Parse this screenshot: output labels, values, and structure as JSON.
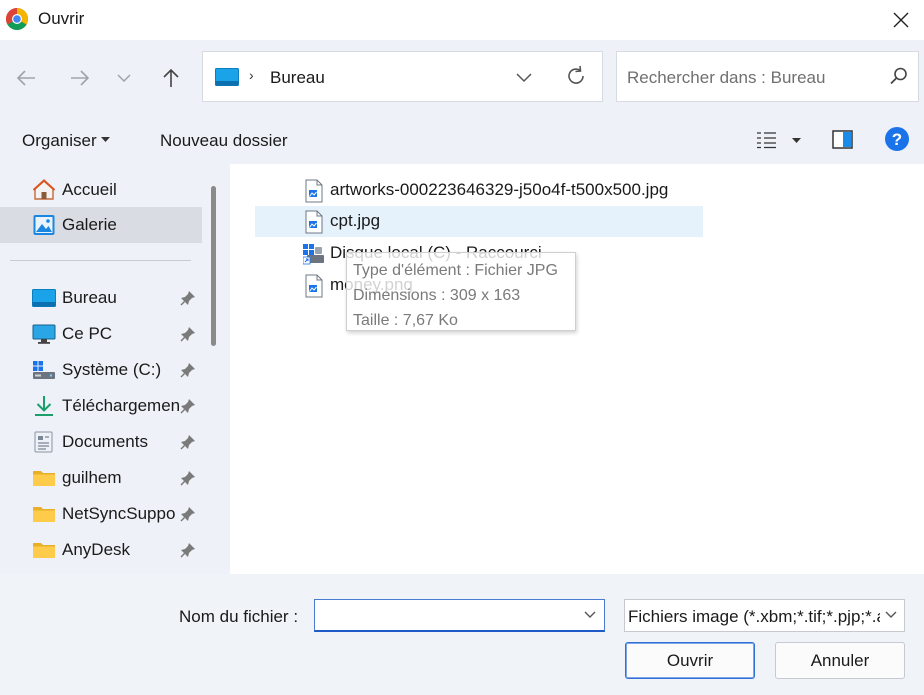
{
  "window": {
    "title": "Ouvrir"
  },
  "address": {
    "crumb": "Bureau"
  },
  "search": {
    "placeholder": "Rechercher dans : Bureau"
  },
  "toolbar": {
    "organize_label": "Organiser",
    "new_folder_label": "Nouveau dossier"
  },
  "sidebar": {
    "items": [
      {
        "label": "Accueil",
        "icon": "home-icon"
      },
      {
        "label": "Galerie",
        "icon": "gallery-icon"
      },
      {
        "label": "Bureau",
        "icon": "desktop-icon"
      },
      {
        "label": "Ce PC",
        "icon": "monitor-icon"
      },
      {
        "label": "Système (C:)",
        "icon": "drive-icon"
      },
      {
        "label": "Téléchargemen",
        "icon": "download-icon"
      },
      {
        "label": "Documents",
        "icon": "documents-icon"
      },
      {
        "label": "guilhem",
        "icon": "folder-icon"
      },
      {
        "label": "NetSyncSuppo",
        "icon": "folder-icon"
      },
      {
        "label": "AnyDesk",
        "icon": "folder-icon"
      }
    ]
  },
  "files": [
    {
      "name": "artworks-000223646329-j50o4f-t500x500.jpg",
      "icon": "image-file-icon"
    },
    {
      "name": "cpt.jpg",
      "icon": "image-file-icon"
    },
    {
      "name": "Disque local (C) - Raccourci",
      "icon": "shortcut-icon"
    },
    {
      "name": "money.png",
      "icon": "image-file-icon"
    }
  ],
  "tooltip": {
    "type": "Type d'élément : Fichier JPG",
    "dimensions": "Dimensions : 309 x 163",
    "size": "Taille : 7,67 Ko"
  },
  "footer": {
    "filename_label": "Nom du fichier :",
    "filename_value": "",
    "filter_value": "Fichiers image (*.xbm;*.tif;*.pjp;*.apng;*.svgz;*.jpeg;*.jpg;*.webp;*.ico)",
    "open_label": "Ouvrir",
    "cancel_label": "Annuler"
  },
  "colors": {
    "accent": "#0067c0",
    "help": "#1a73e8",
    "selection": "#e5f1fb"
  }
}
